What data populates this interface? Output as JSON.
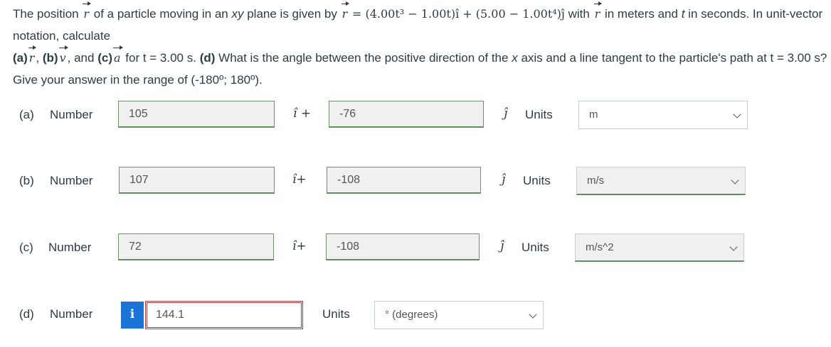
{
  "problem": {
    "p1": "The position",
    "p2": "of a particle moving in an",
    "p3": "xy",
    "p4": "plane is given by",
    "equation": "= (4.00t³ − 1.00t)î + (5.00 − 1.00t⁴)ĵ",
    "p5": "with",
    "p6": "in meters and",
    "p7": "t",
    "p8": "in seconds. In unit-vector notation, calculate",
    "a_label": "(a)",
    "b_label": "(b)",
    "c_label": "(c)",
    "d_label": "(d)",
    "p9": ", and",
    "p10": "for t = 3.00 s.",
    "p11": "What is the angle between the positive direction of the",
    "p12": "x",
    "p13": "axis and a line tangent to the particle's path at t = 3.00 s? Give your answer in the range of (-180º; 180º).",
    "r_symbol": "r",
    "v_symbol": "v",
    "a_symbol": "a"
  },
  "rows": [
    {
      "part": "(a)",
      "number_label": "Number",
      "i_value": "105",
      "i_unit": "î +",
      "j_value": "-76",
      "j_unit": "ĵ",
      "units_label": "Units",
      "units_value": "m"
    },
    {
      "part": "(b)",
      "number_label": "Number",
      "i_value": "107",
      "i_unit": "î+",
      "j_value": "-108",
      "j_unit": "ĵ",
      "units_label": "Units",
      "units_value": "m/s"
    },
    {
      "part": "(c)",
      "number_label": "Number",
      "i_value": "72",
      "i_unit": "î+",
      "j_value": "-108",
      "j_unit": "ĵ",
      "units_label": "Units",
      "units_value": "m/s^2"
    }
  ],
  "row_d": {
    "part": "(d)",
    "number_label": "Number",
    "info": "i",
    "value": "144.1",
    "units_label": "Units",
    "units_value": "° (degrees)"
  }
}
